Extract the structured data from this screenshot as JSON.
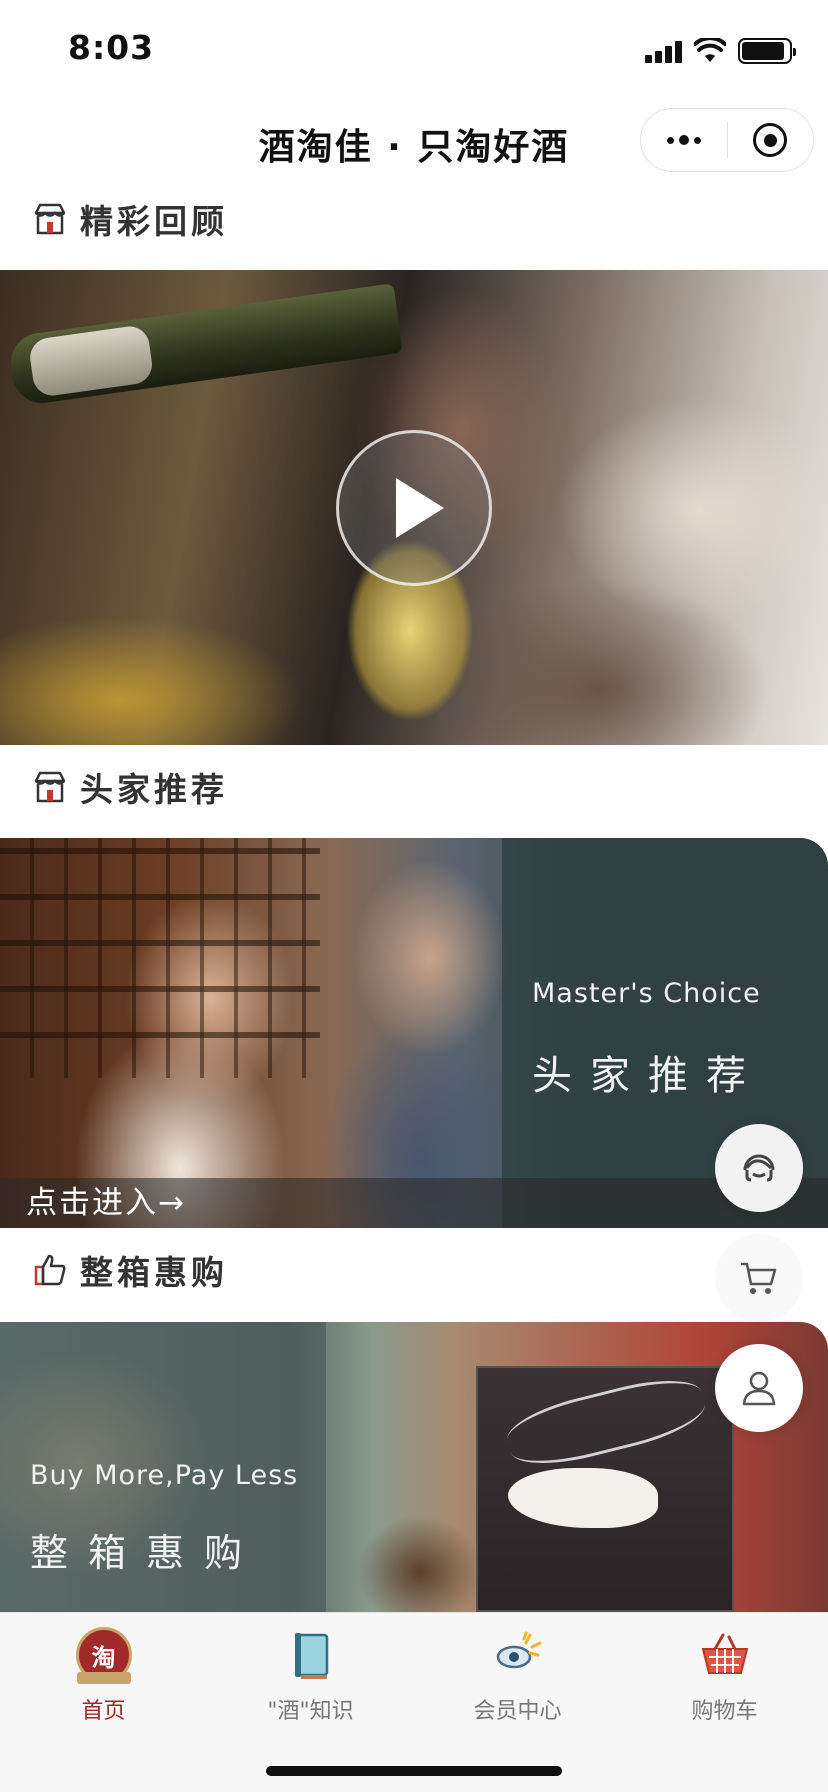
{
  "status_bar": {
    "time": "8:03"
  },
  "nav": {
    "title": "酒淘佳 · 只淘好酒"
  },
  "sections": {
    "review": {
      "title": "精彩回顾"
    },
    "recommend": {
      "title": "头家推荐"
    },
    "case": {
      "title": "整箱惠购"
    }
  },
  "master_banner": {
    "en": "Master's Choice",
    "cn": "头家推荐",
    "enter": "点击进入→"
  },
  "case_banner": {
    "en": "Buy More,Pay Less",
    "cn": "整箱惠购"
  },
  "tabs": [
    {
      "label": "首页",
      "icon": "home-seal-icon",
      "active": true
    },
    {
      "label": "\"酒\"知识",
      "icon": "book-icon",
      "active": false
    },
    {
      "label": "会员中心",
      "icon": "member-icon",
      "active": false
    },
    {
      "label": "购物车",
      "icon": "basket-icon",
      "active": false
    }
  ],
  "seal_text": "淘",
  "colors": {
    "accent": "#9b2b2b",
    "inactive": "#777777"
  }
}
